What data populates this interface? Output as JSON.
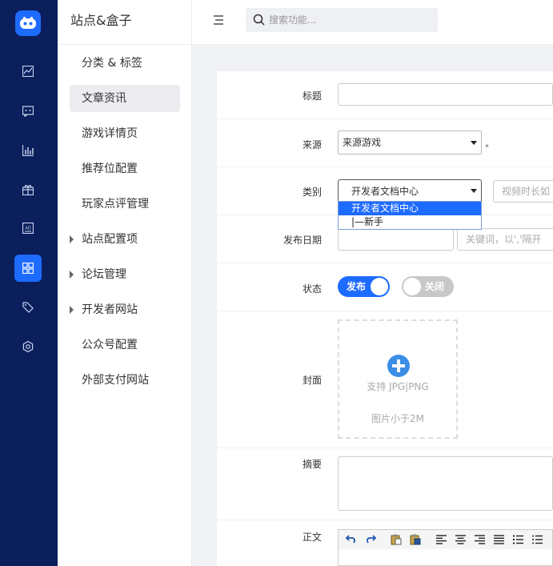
{
  "topbar": {
    "search_placeholder": "搜索功能..."
  },
  "sidebar": {
    "title": "站点&盒子",
    "items": [
      {
        "label": "分类 & 标签",
        "expandable": false,
        "active": false
      },
      {
        "label": "文章资讯",
        "expandable": false,
        "active": true
      },
      {
        "label": "游戏详情页",
        "expandable": false,
        "active": false
      },
      {
        "label": "推荐位配置",
        "expandable": false,
        "active": false
      },
      {
        "label": "玩家点评管理",
        "expandable": false,
        "active": false
      },
      {
        "label": "站点配置项",
        "expandable": true,
        "active": false
      },
      {
        "label": "论坛管理",
        "expandable": true,
        "active": false
      },
      {
        "label": "开发者网站",
        "expandable": true,
        "active": false
      },
      {
        "label": "公众号配置",
        "expandable": false,
        "active": false
      },
      {
        "label": "外部支付网站",
        "expandable": false,
        "active": false
      }
    ]
  },
  "rail": {
    "icons": [
      "logo-icon",
      "chart-line-icon",
      "message-icon",
      "bar-chart-icon",
      "gift-icon",
      "ad-icon",
      "grid-icon",
      "tag-icon",
      "settings-icon"
    ],
    "active_index": 6
  },
  "form": {
    "title": {
      "label": "标题",
      "value": ""
    },
    "source": {
      "label": "来源",
      "value": "来源游戏",
      "required_mark": "*"
    },
    "category": {
      "label": "类别",
      "value": "开发者文档中心",
      "options": [
        "开发者文档中心",
        "|—新手"
      ],
      "extra_placeholder": "视频时长如"
    },
    "publish_date": {
      "label": "发布日期",
      "value": "",
      "keywords_placeholder": "关键词，以','隔开"
    },
    "status": {
      "label": "状态",
      "publish_label": "发布",
      "publish_on": true,
      "close_label": "关闭",
      "close_on": false
    },
    "cover": {
      "label": "封面",
      "hint_format": "支持 JPG|PNG",
      "hint_size": "图片小于2M"
    },
    "summary": {
      "label": "摘要",
      "value": ""
    },
    "body": {
      "label": "正文"
    }
  },
  "colors": {
    "rail_bg": "#0b1f5c",
    "accent": "#1e6bff",
    "toggle_off": "#c8c8c8",
    "upload_icon": "#3a8ee6"
  }
}
